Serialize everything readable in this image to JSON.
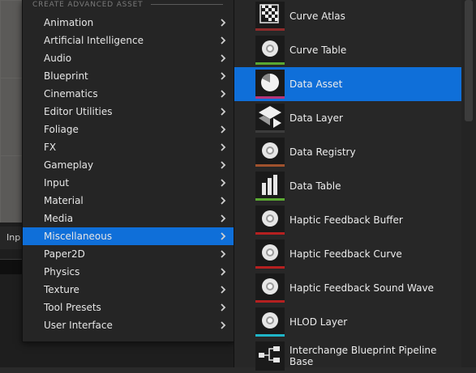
{
  "background": {
    "tab_label": "Inp"
  },
  "menu": {
    "header": "CREATE ADVANCED ASSET",
    "items": [
      {
        "label": "Animation",
        "selected": false
      },
      {
        "label": "Artificial Intelligence",
        "selected": false
      },
      {
        "label": "Audio",
        "selected": false
      },
      {
        "label": "Blueprint",
        "selected": false
      },
      {
        "label": "Cinematics",
        "selected": false
      },
      {
        "label": "Editor Utilities",
        "selected": false
      },
      {
        "label": "Foliage",
        "selected": false
      },
      {
        "label": "FX",
        "selected": false
      },
      {
        "label": "Gameplay",
        "selected": false
      },
      {
        "label": "Input",
        "selected": false
      },
      {
        "label": "Material",
        "selected": false
      },
      {
        "label": "Media",
        "selected": false
      },
      {
        "label": "Miscellaneous",
        "selected": true
      },
      {
        "label": "Paper2D",
        "selected": false
      },
      {
        "label": "Physics",
        "selected": false
      },
      {
        "label": "Texture",
        "selected": false
      },
      {
        "label": "Tool Presets",
        "selected": false
      },
      {
        "label": "User Interface",
        "selected": false
      }
    ]
  },
  "submenu": {
    "items": [
      {
        "label": "Curve Atlas",
        "icon": "checker-icon",
        "stripe": "#8e2b2b",
        "selected": false
      },
      {
        "label": "Curve Table",
        "icon": "sphere-icon",
        "stripe": "#5aa832",
        "selected": false
      },
      {
        "label": "Data Asset",
        "icon": "pie-chart-icon",
        "stripe": "#b5367a",
        "selected": true
      },
      {
        "label": "Data Layer",
        "icon": "layers-icon",
        "stripe": "#3c3c3c",
        "selected": false
      },
      {
        "label": "Data Registry",
        "icon": "sphere-icon",
        "stripe": "#a0522d",
        "selected": false
      },
      {
        "label": "Data Table",
        "icon": "bar-chart-icon",
        "stripe": "#5aa832",
        "selected": false
      },
      {
        "label": "Haptic Feedback Buffer",
        "icon": "sphere-icon",
        "stripe": "#b52020",
        "selected": false
      },
      {
        "label": "Haptic Feedback Curve",
        "icon": "sphere-icon",
        "stripe": "#b52020",
        "selected": false
      },
      {
        "label": "Haptic Feedback Sound Wave",
        "icon": "sphere-icon",
        "stripe": "#b52020",
        "selected": false
      },
      {
        "label": "HLOD Layer",
        "icon": "sphere-icon",
        "stripe": "#1fb5c8",
        "selected": false
      },
      {
        "label": "Interchange Blueprint Pipeline Base",
        "icon": "node-graph-icon",
        "stripe": "#1a1a1a",
        "selected": false
      }
    ]
  },
  "colors": {
    "selection": "#0f6fd9",
    "menu_bg": "#252525",
    "text": "#e6e6e6"
  }
}
